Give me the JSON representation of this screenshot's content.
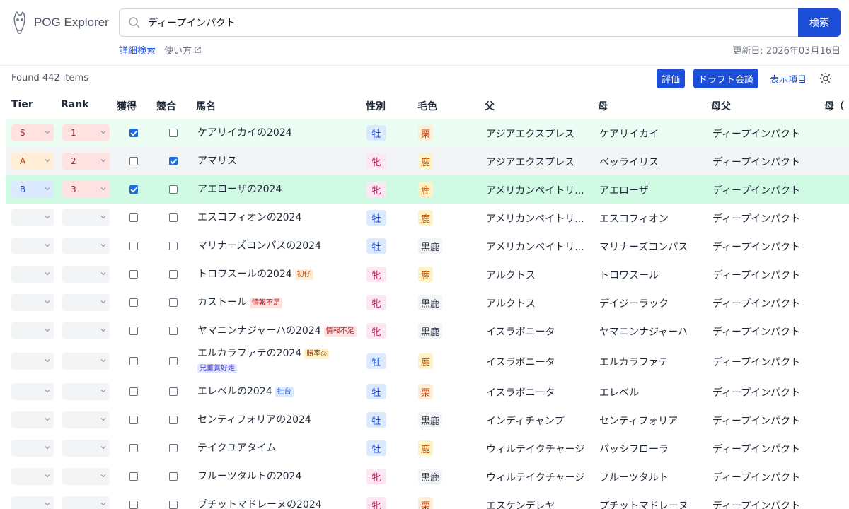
{
  "app": {
    "title": "POG Explorer",
    "search_value": "ディープインパクト",
    "search_button": "検索",
    "advanced_search": "詳細検索",
    "help_link": "使い方",
    "updated": "更新日: 2026年03月16日"
  },
  "toolbar": {
    "found": "Found 442 items",
    "eval_button": "評価",
    "draft_button": "ドラフト会議",
    "columns_link": "表示項目"
  },
  "colors": {
    "accent": "#1d4ed8"
  },
  "table": {
    "headers": {
      "tier": "Tier",
      "rank": "Rank",
      "acquired": "獲得",
      "conflict": "競合",
      "name": "馬名",
      "sex": "性別",
      "coat": "毛色",
      "sire": "父",
      "dam": "母",
      "damsire": "母父",
      "more": "母（"
    },
    "rows": [
      {
        "tier": "S",
        "rank": "1",
        "acquired": true,
        "conflict": false,
        "name": "ケアリイカイの2024",
        "badges": [],
        "sex": "牡",
        "coat": "栗",
        "sire": "アジアエクスプレス",
        "dam": "ケアリイカイ",
        "damsire": "ディープインパクト",
        "bg": "green"
      },
      {
        "tier": "A",
        "rank": "2",
        "acquired": false,
        "conflict": true,
        "name": "アマリス",
        "badges": [],
        "sex": "牝",
        "coat": "鹿",
        "sire": "アジアエクスプレス",
        "dam": "ベッライリス",
        "damsire": "ディープインパクト",
        "bg": "gray"
      },
      {
        "tier": "B",
        "rank": "3",
        "acquired": true,
        "conflict": false,
        "name": "アエローザの2024",
        "badges": [],
        "sex": "牝",
        "coat": "鹿",
        "sire": "アメリカンペイトリ...",
        "dam": "アエローザ",
        "damsire": "ディープインパクト",
        "bg": "green2"
      },
      {
        "tier": "",
        "rank": "",
        "acquired": false,
        "conflict": false,
        "name": "エスコフィオンの2024",
        "badges": [],
        "sex": "牡",
        "coat": "鹿",
        "sire": "アメリカンペイトリ...",
        "dam": "エスコフィオン",
        "damsire": "ディープインパクト",
        "bg": ""
      },
      {
        "tier": "",
        "rank": "",
        "acquired": false,
        "conflict": false,
        "name": "マリナーズコンパスの2024",
        "badges": [],
        "sex": "牡",
        "coat": "黒鹿",
        "sire": "アメリカンペイトリ...",
        "dam": "マリナーズコンパス",
        "damsire": "ディープインパクト",
        "bg": ""
      },
      {
        "tier": "",
        "rank": "",
        "acquired": false,
        "conflict": false,
        "name": "トロワスールの2024",
        "badges": [
          {
            "text": "初仔",
            "style": "orange"
          }
        ],
        "sex": "牝",
        "coat": "鹿",
        "sire": "アルクトス",
        "dam": "トロワスール",
        "damsire": "ディープインパクト",
        "bg": ""
      },
      {
        "tier": "",
        "rank": "",
        "acquired": false,
        "conflict": false,
        "name": "カストール",
        "badges": [
          {
            "text": "情報不足",
            "style": "red"
          }
        ],
        "sex": "牝",
        "coat": "黒鹿",
        "sire": "アルクトス",
        "dam": "デイジーラック",
        "damsire": "ディープインパクト",
        "bg": ""
      },
      {
        "tier": "",
        "rank": "",
        "acquired": false,
        "conflict": false,
        "name": "ヤマニンナジャーハの2024",
        "badges": [
          {
            "text": "情報不足",
            "style": "red"
          }
        ],
        "sex": "牝",
        "coat": "黒鹿",
        "sire": "イスラボニータ",
        "dam": "ヤマニンナジャーハ",
        "damsire": "ディープインパクト",
        "bg": ""
      },
      {
        "tier": "",
        "rank": "",
        "acquired": false,
        "conflict": false,
        "name": "エルカラファテの2024",
        "badges": [
          {
            "text": "勝率◎",
            "style": "yellow"
          },
          {
            "text": "兄重賞好走",
            "style": "purple"
          }
        ],
        "sex": "牡",
        "coat": "鹿",
        "sire": "イスラボニータ",
        "dam": "エルカラファテ",
        "damsire": "ディープインパクト",
        "bg": ""
      },
      {
        "tier": "",
        "rank": "",
        "acquired": false,
        "conflict": false,
        "name": "エレベルの2024",
        "badges": [
          {
            "text": "社台",
            "style": "blue"
          }
        ],
        "sex": "牡",
        "coat": "栗",
        "sire": "イスラボニータ",
        "dam": "エレベル",
        "damsire": "ディープインパクト",
        "bg": ""
      },
      {
        "tier": "",
        "rank": "",
        "acquired": false,
        "conflict": false,
        "name": "センティフォリアの2024",
        "badges": [],
        "sex": "牡",
        "coat": "黒鹿",
        "sire": "インディチャンプ",
        "dam": "センティフォリア",
        "damsire": "ディープインパクト",
        "bg": ""
      },
      {
        "tier": "",
        "rank": "",
        "acquired": false,
        "conflict": false,
        "name": "テイクユアタイム",
        "badges": [],
        "sex": "牡",
        "coat": "鹿",
        "sire": "ウィルテイクチャージ",
        "dam": "パッシフローラ",
        "damsire": "ディープインパクト",
        "bg": ""
      },
      {
        "tier": "",
        "rank": "",
        "acquired": false,
        "conflict": false,
        "name": "フルーツタルトの2024",
        "badges": [],
        "sex": "牝",
        "coat": "黒鹿",
        "sire": "ウィルテイクチャージ",
        "dam": "フルーツタルト",
        "damsire": "ディープインパクト",
        "bg": ""
      },
      {
        "tier": "",
        "rank": "",
        "acquired": false,
        "conflict": false,
        "name": "プチットマドレーヌの2024",
        "badges": [],
        "sex": "牝",
        "coat": "栗",
        "sire": "エスケンデレヤ",
        "dam": "プチットマドレーヌ",
        "damsire": "ディープインパクト",
        "bg": ""
      }
    ]
  }
}
